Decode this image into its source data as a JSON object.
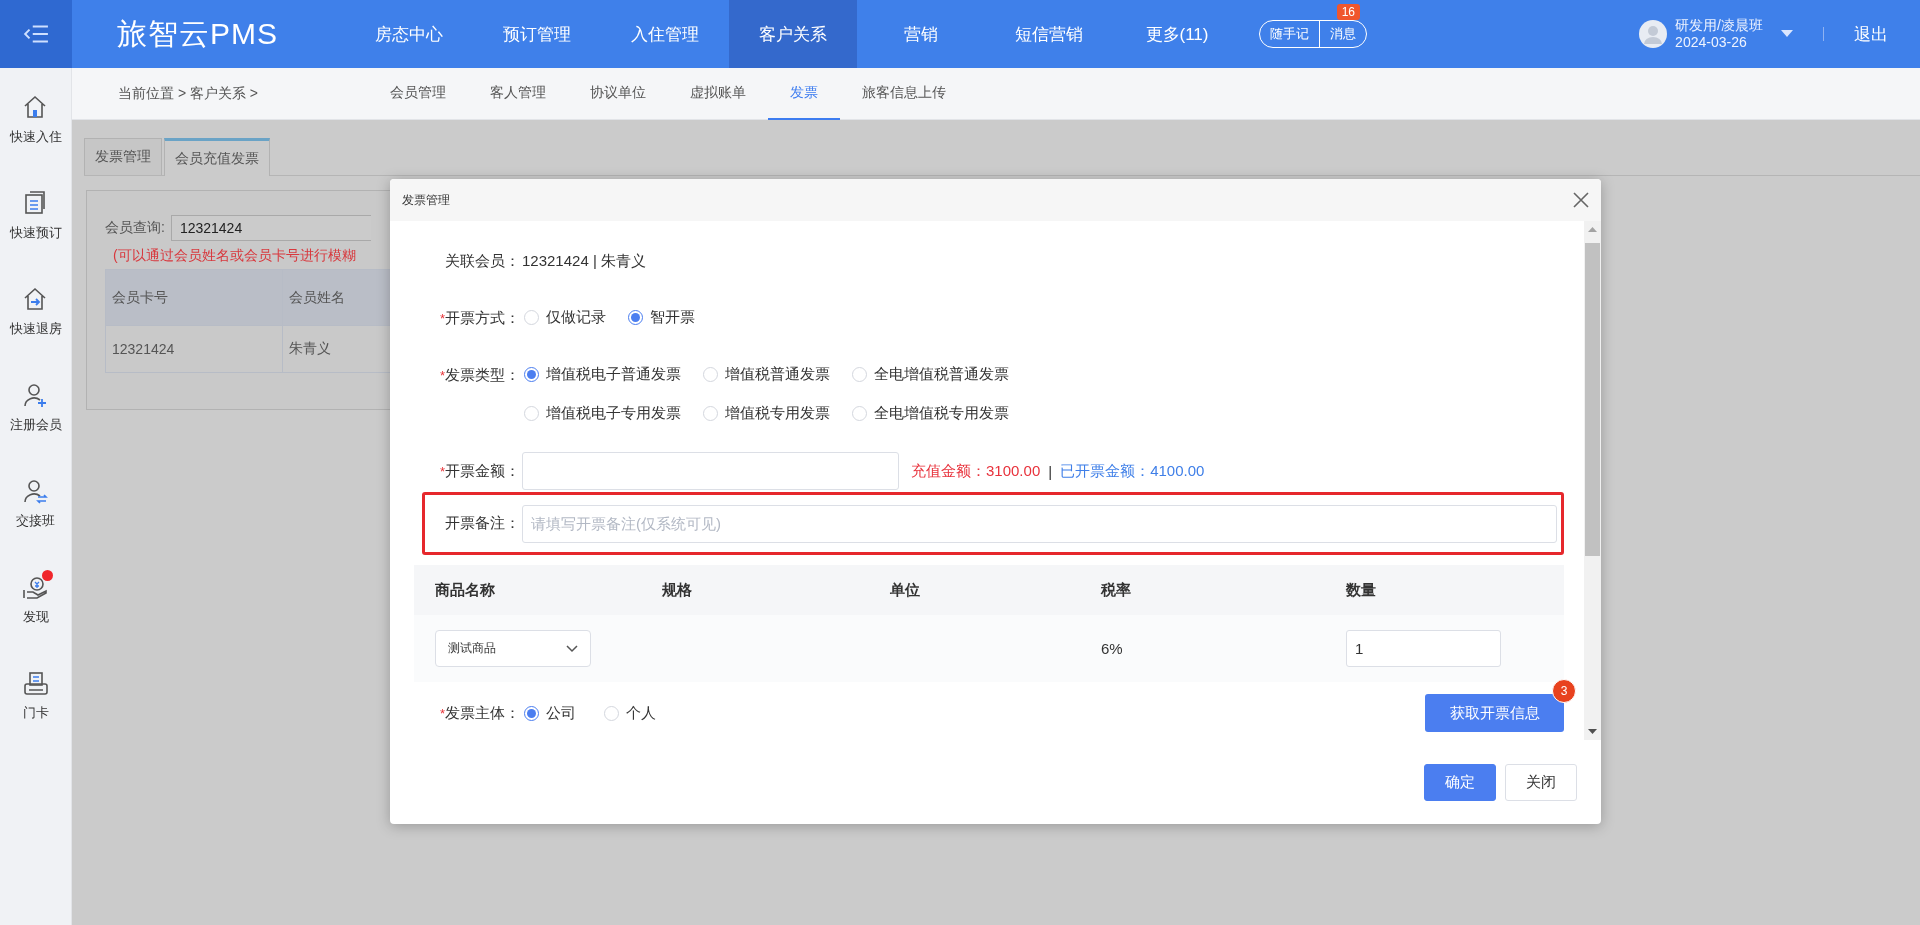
{
  "topbar": {
    "logo": "旅智云PMS",
    "nav": [
      {
        "label": "房态中心",
        "selected": false
      },
      {
        "label": "预订管理",
        "selected": false
      },
      {
        "label": "入住管理",
        "selected": false
      },
      {
        "label": "客户关系",
        "selected": true
      },
      {
        "label": "营销",
        "selected": false
      },
      {
        "label": "短信营销",
        "selected": false
      },
      {
        "label": "更多(11)",
        "selected": false
      }
    ],
    "quick_buttons": [
      {
        "label": "随手记"
      },
      {
        "label": "消息",
        "badge": "16"
      }
    ],
    "user": {
      "name": "研发用/凌晨班",
      "date": "2024-03-26"
    },
    "logout": "退出"
  },
  "subnav": {
    "breadcrumb": "当前位置 > 客户关系 >",
    "tabs": [
      {
        "label": "会员管理",
        "selected": false
      },
      {
        "label": "客人管理",
        "selected": false
      },
      {
        "label": "协议单位",
        "selected": false
      },
      {
        "label": "虚拟账单",
        "selected": false
      },
      {
        "label": "发票",
        "selected": true
      },
      {
        "label": "旅客信息上传",
        "selected": false
      }
    ]
  },
  "sidebar": {
    "items": [
      {
        "kind": "home",
        "label": "快速入住",
        "dot": false
      },
      {
        "kind": "booking",
        "label": "快速预订",
        "dot": false
      },
      {
        "kind": "checkout",
        "label": "快速退房",
        "dot": false
      },
      {
        "kind": "register",
        "label": "注册会员",
        "dot": false
      },
      {
        "kind": "shift",
        "label": "交接班",
        "dot": false
      },
      {
        "kind": "discover",
        "label": "发现",
        "dot": true
      },
      {
        "kind": "card",
        "label": "门卡",
        "dot": false
      }
    ]
  },
  "page": {
    "tabs": [
      {
        "label": "发票管理",
        "selected": false
      },
      {
        "label": "会员充值发票",
        "selected": true
      }
    ],
    "search": {
      "label": "会员查询:",
      "value": "12321424"
    },
    "hint": "(可以通过会员姓名或会员卡号进行模糊",
    "table": {
      "columns": [
        "会员卡号",
        "会员姓名"
      ],
      "rows": [
        [
          "12321424",
          "朱青义"
        ]
      ]
    }
  },
  "dialog": {
    "title": "发票管理",
    "required_mark": "*",
    "member": {
      "label": "关联会员：",
      "value": "12321424 | 朱青义"
    },
    "fields": [
      {
        "kind": "radio",
        "label": "开票方式：",
        "required": true,
        "options": [
          {
            "label": "仅做记录",
            "selected": false
          },
          {
            "label": "智开票",
            "selected": true
          }
        ]
      },
      {
        "kind": "radio",
        "label": "发票类型：",
        "required": true,
        "options": [
          {
            "label": "增值税电子普通发票",
            "selected": true
          },
          {
            "label": "增值税普通发票",
            "selected": false
          },
          {
            "label": "全电增值税普通发票",
            "selected": false
          },
          {
            "label": "增值税电子专用发票",
            "selected": false
          },
          {
            "label": "增值税专用发票",
            "selected": false
          },
          {
            "label": "全电增值税专用发票",
            "selected": false
          }
        ]
      },
      {
        "kind": "amount",
        "label": "开票金额：",
        "required": true,
        "recharge": "充值金额：3100.00",
        "separator": "|",
        "invoiced": "已开票金额：4100.00"
      },
      {
        "kind": "remark",
        "label": "开票备注：",
        "required": false,
        "placeholder": "请填写开票备注(仅系统可见)",
        "highlighted": true
      }
    ],
    "goods": {
      "columns": [
        "商品名称",
        "规格",
        "单位",
        "税率",
        "数量"
      ],
      "rows": [
        {
          "product": "测试商品",
          "tax_rate": "6%",
          "quantity": "1"
        }
      ]
    },
    "subject": {
      "label": "发票主体：",
      "required": true,
      "options": [
        {
          "label": "公司",
          "selected": true
        },
        {
          "label": "个人",
          "selected": false
        }
      ]
    },
    "fetch_button": {
      "label": "获取开票信息",
      "badge": "3"
    },
    "buttons": [
      {
        "kind": "primary",
        "label": "确定"
      },
      {
        "kind": "default",
        "label": "关闭"
      }
    ]
  }
}
